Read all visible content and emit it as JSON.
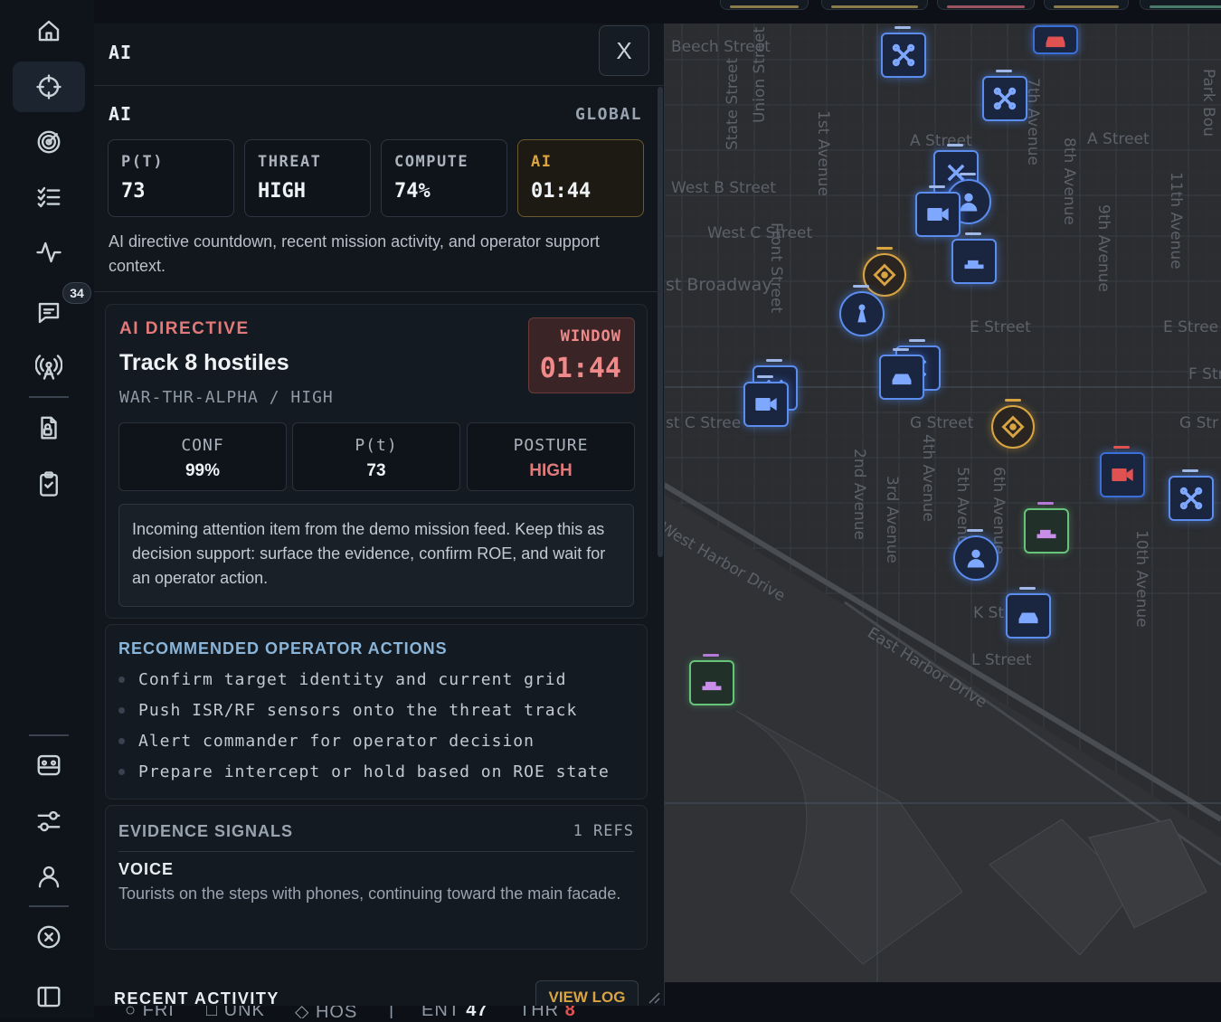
{
  "panel": {
    "title": "AI",
    "close_label": "X"
  },
  "summary": {
    "title": "AI",
    "scope": "GLOBAL",
    "stats": [
      {
        "label": "P(T)",
        "value": "73"
      },
      {
        "label": "THREAT",
        "value": "HIGH"
      },
      {
        "label": "COMPUTE",
        "value": "74%"
      },
      {
        "label": "AI",
        "value": "01:44"
      }
    ],
    "description": "AI directive countdown, recent mission activity, and operator support context."
  },
  "directive": {
    "kicker": "AI DIRECTIVE",
    "title": "Track 8 hostiles",
    "code": "WAR-THR-ALPHA / HIGH",
    "window_label": "WINDOW",
    "window_value": "01:44",
    "metrics": [
      {
        "label": "CONF",
        "value": "99%"
      },
      {
        "label": "P(t)",
        "value": "73"
      },
      {
        "label": "POSTURE",
        "value": "HIGH"
      }
    ],
    "note": "Incoming attention item from the demo mission feed. Keep this as decision support: surface the evidence, confirm ROE, and wait for an operator action."
  },
  "actions": {
    "title": "RECOMMENDED OPERATOR ACTIONS",
    "items": [
      "Confirm target identity and current grid",
      "Push ISR/RF sensors onto the threat track",
      "Alert commander for operator decision",
      "Prepare intercept or hold based on ROE state"
    ]
  },
  "evidence": {
    "title": "EVIDENCE SIGNALS",
    "refs": "1 REFS",
    "kind": "VOICE",
    "text": "Tourists on the steps with phones, continuing toward the main facade."
  },
  "recent": {
    "title": "RECENT ACTIVITY",
    "view_log": "VIEW LOG"
  },
  "rail": {
    "message_badge": "34",
    "icons": [
      "home-icon",
      "crosshair-icon",
      "radar-icon",
      "checklist-icon",
      "activity-icon",
      "messages-icon",
      "antenna-icon",
      "file-lock-icon",
      "clipboard-check-icon",
      "scan-icon",
      "sliders-icon",
      "user-icon",
      "close-circle-icon",
      "sidebar-toggle-icon"
    ]
  },
  "statusbar": {
    "items": [
      {
        "label": "FRI",
        "value": ""
      },
      {
        "label": "UNK",
        "value": ""
      },
      {
        "label": "HOS",
        "value": ""
      },
      {
        "label": "ENT",
        "value": "47"
      },
      {
        "label": "THR",
        "value": "8"
      }
    ]
  },
  "map": {
    "streets": [
      "Beech Street",
      "West B Street",
      "West C Street",
      "st Broadway",
      "st C Stree",
      "West Harbor Drive",
      "East Harbor Drive",
      "A Street",
      "A Street",
      "E Street",
      "E Stree",
      "G Street",
      "G Str",
      "F Str",
      "K St",
      "L Street",
      "State Street",
      "Union Street",
      "Front Street",
      "1st Avenue",
      "2nd Avenue",
      "3rd Avenue",
      "4th Avenue",
      "5th Avenue",
      "6th Avenue",
      "7th Avenue",
      "8th Avenue",
      "9th Avenue",
      "10th Avenue",
      "11th Avenue",
      "Park Bou",
      "Broadway",
      "Street",
      "Avenue",
      "6th",
      "7th",
      "2nd"
    ],
    "colors": {
      "friendly": "#5b8def",
      "hostile": "#e05252",
      "neutral": "#67c27a",
      "unknown": "#d9a441"
    }
  }
}
